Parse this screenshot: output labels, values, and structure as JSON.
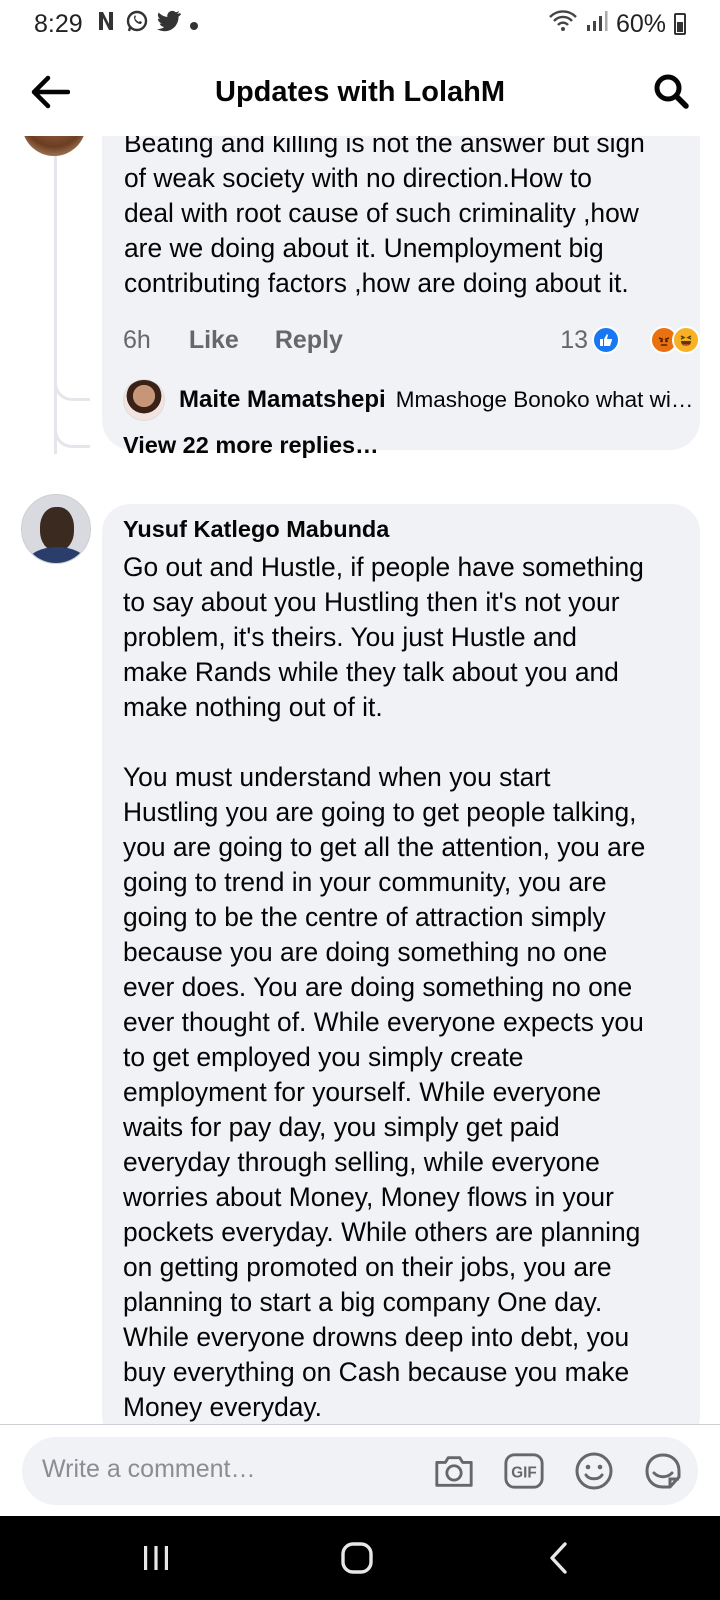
{
  "status_bar": {
    "time": "8:29",
    "battery": "60%",
    "notification_icons": [
      "netflix-icon",
      "whatsapp-icon",
      "twitter-icon",
      "dot-icon"
    ],
    "system_icons": [
      "wifi-icon",
      "signal-icon",
      "battery-icon"
    ]
  },
  "header": {
    "title": "Updates with LolahM"
  },
  "comment_1": {
    "text": "Beating and killing is not the answer but sign\nof weak society with no direction.How to\ndeal with root cause of such criminality ,how\nare we doing about it. Unemployment big\ncontributing factors ,how are doing about it.",
    "time": "6h",
    "like_label": "Like",
    "reply_label": "Reply",
    "reaction_count": "13",
    "reactions": [
      "like-reaction",
      "angry-reaction",
      "haha-reaction"
    ],
    "reply_preview": {
      "name": "Maite Mamatshepi",
      "text": "Mmashoge Bonoko what wi…"
    },
    "view_more": "View 22 more replies…"
  },
  "comment_2": {
    "name": "Yusuf Katlego Mabunda",
    "text": "Go out and Hustle, if people have something\nto say about you Hustling then it's not your\nproblem, it's theirs. You just Hustle and\nmake Rands while they talk about you and\nmake nothing out of it.\n\nYou must understand when you start\nHustling you are going to get people talking,\nyou are going to get all the attention, you are\ngoing to trend in your community, you are\ngoing to be the centre of attraction simply\nbecause you are doing something no one\never does. You are doing something no one\never thought of. While everyone expects you\nto get employed you simply create\nemployment for yourself. While everyone\nwaits for pay day, you simply get paid\neveryday through selling, while everyone\nworries about Money, Money flows in your\npockets everyday. While others are planning\non getting promoted on their jobs, you are\nplanning to start a big company One day.\nWhile everyone drowns deep into debt, you\nbuy everything on Cash because you make\nMoney everyday."
  },
  "composer": {
    "placeholder": "Write a comment…",
    "icons": [
      "camera-icon",
      "gif-icon",
      "emoji-icon",
      "sticker-icon"
    ]
  },
  "nav_bar": {
    "buttons": [
      "recents-button",
      "home-button",
      "back-button"
    ]
  }
}
